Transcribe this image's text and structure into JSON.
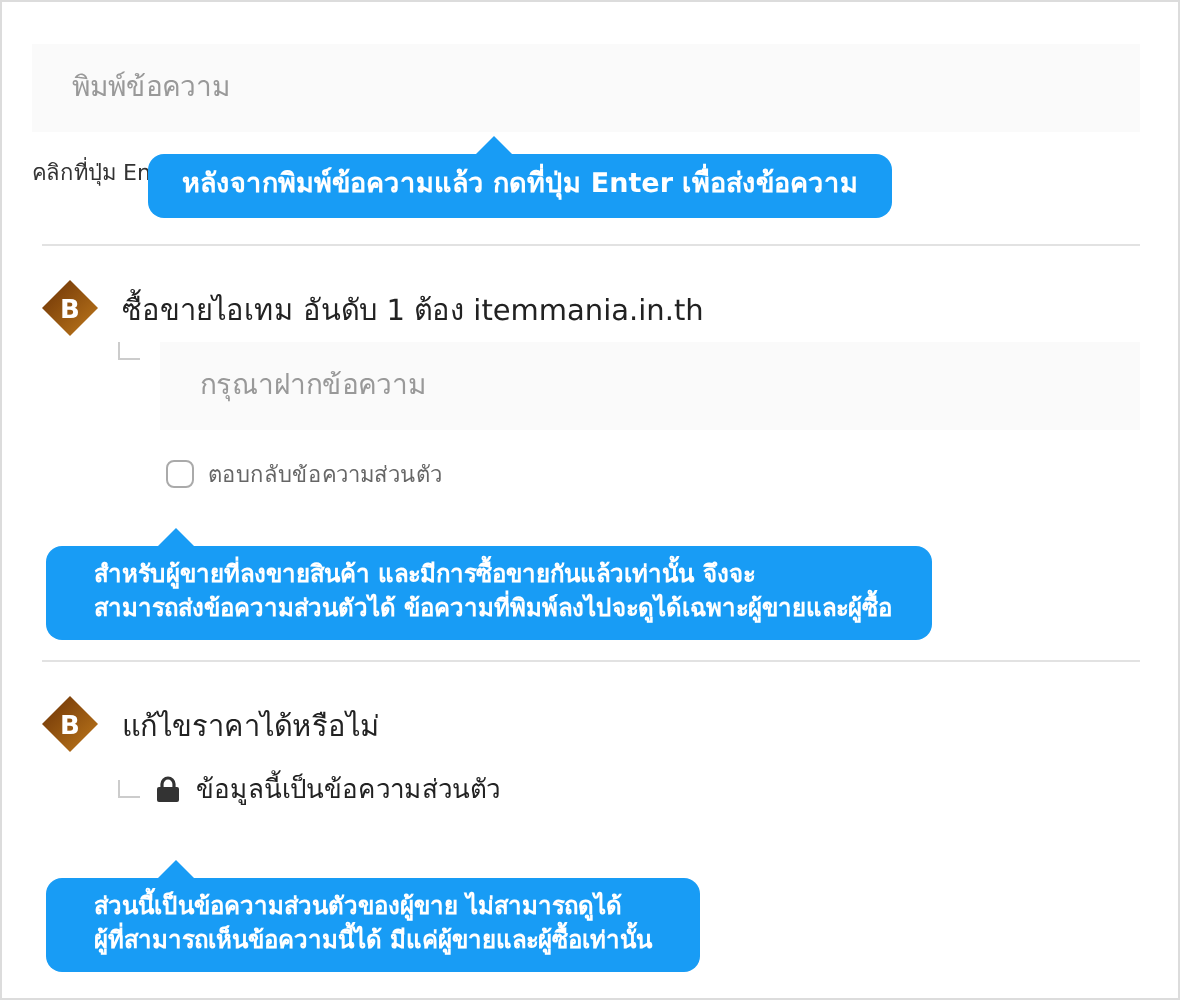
{
  "message_field": {
    "placeholder": "พิมพ์ข้อความ"
  },
  "hint": "คลิกที่ปุ่ม En",
  "tooltip": "หลังจากพิมพ์ข้อความแล้ว กดที่ปุ่ม Enter เพื่อส่งข้อความ",
  "posts": [
    {
      "kind": "reply",
      "badge": "B",
      "title": "ซื้อขายไอเทม อันดับ 1 ต้อง itemmania.in.th",
      "reply_field": {
        "placeholder": "กรุณาฝากข้อความ"
      },
      "private_reply": {
        "label": "ตอบกลับข้อความส่วนตัว",
        "checked": false
      },
      "tooltip": [
        "สำหรับผู้ขายที่ลงขายสินค้า และมีการซื้อขายกันแล้วเท่านั้น จึงจะ",
        "สามารถส่งข้อความส่วนตัวได้  ข้อความที่พิมพ์ลงไปจะดูได้เฉพาะผู้ขายและผู้ซื้อ"
      ]
    },
    {
      "kind": "private",
      "badge": "B",
      "title": "แก้ไขราคาได้หรือไม่",
      "private_notice": "ข้อมูลนี้เป็นข้อความส่วนตัว",
      "tooltip": [
        "ส่วนนี้เป็นข้อความส่วนตัวของผู้ขาย ไม่สามารถดูได้",
        "ผู้ที่สามารถเห็นข้อความนี้ได้ มีแค่ผู้ขายและผู้ซื้อเท่านั้น"
      ]
    }
  ]
}
